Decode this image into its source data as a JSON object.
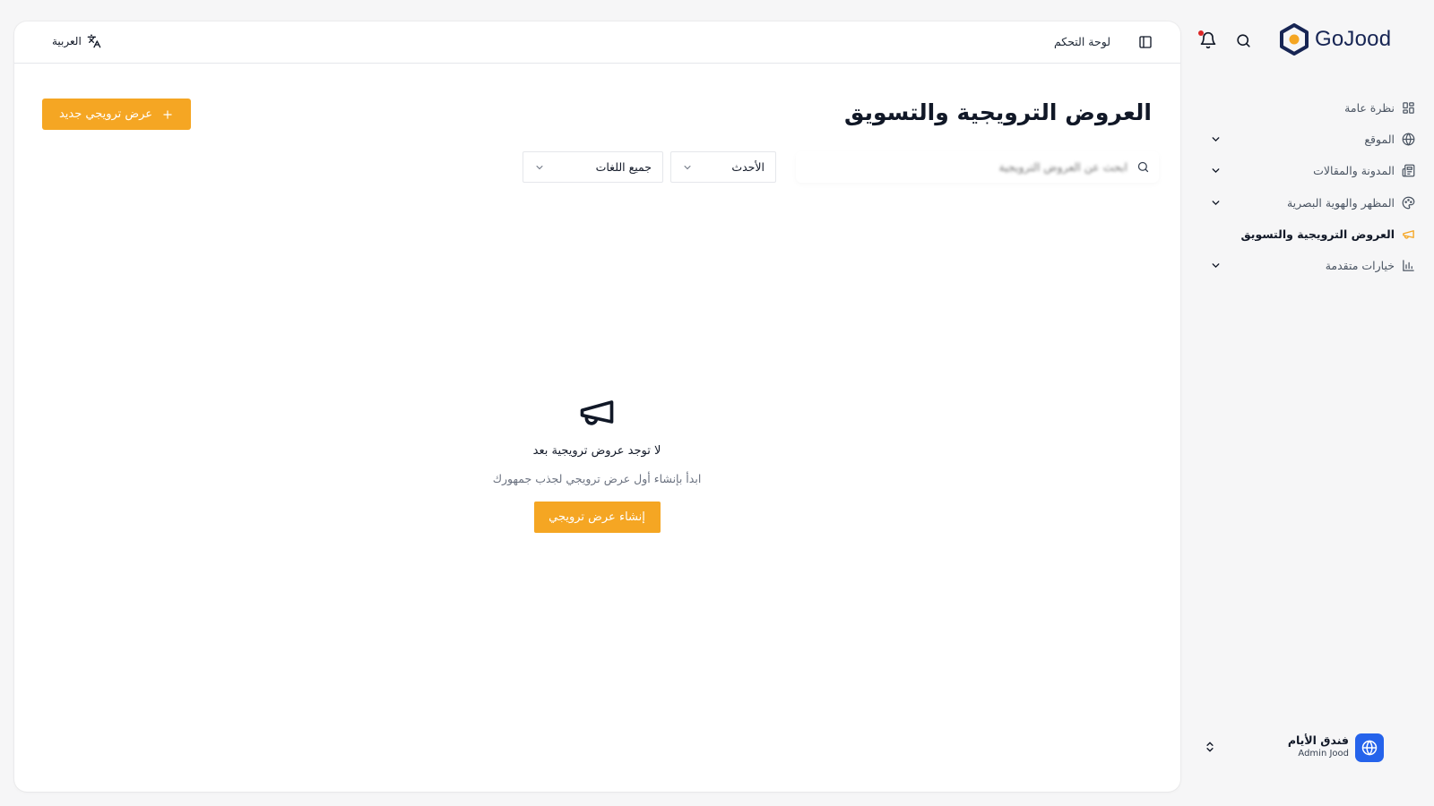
{
  "app": {
    "brand": "GoJood",
    "accent_color": "#f5a623",
    "brand_color": "#172554"
  },
  "header": {
    "language_label": "العربية",
    "breadcrumb": "لوحة التحكم"
  },
  "page": {
    "title": "العروض الترويجية والتسويق",
    "new_button_label": "عرض ترويجي جديد",
    "search_placeholder": "ابحث عن العروض الترويجية",
    "sort_selected": "الأحدث",
    "language_filter_selected": "جميع اللغات"
  },
  "empty_state": {
    "icon": "megaphone-icon",
    "title": "لا توجد عروض ترويجية بعد",
    "subtitle": "ابدأ بإنشاء أول عرض ترويجي لجذب جمهورك",
    "button_label": "إنشاء عرض ترويجي"
  },
  "sidebar": {
    "items": [
      {
        "label": "نظرة عامة",
        "icon": "overview-grid-icon",
        "expandable": false,
        "active": false
      },
      {
        "label": "الموقع",
        "icon": "globe-icon",
        "expandable": true,
        "active": false
      },
      {
        "label": "المدونة والمقالات",
        "icon": "newspaper-icon",
        "expandable": true,
        "active": false
      },
      {
        "label": "المظهر والهوية البصرية",
        "icon": "palette-icon",
        "expandable": true,
        "active": false
      },
      {
        "label": "العروض الترويجية والتسويق",
        "icon": "megaphone-icon",
        "expandable": false,
        "active": true
      },
      {
        "label": "خيارات متقدمة",
        "icon": "bar-chart-icon",
        "expandable": true,
        "active": false
      }
    ]
  },
  "account": {
    "name": "فندق الأيام",
    "role": "Admin Jood"
  }
}
